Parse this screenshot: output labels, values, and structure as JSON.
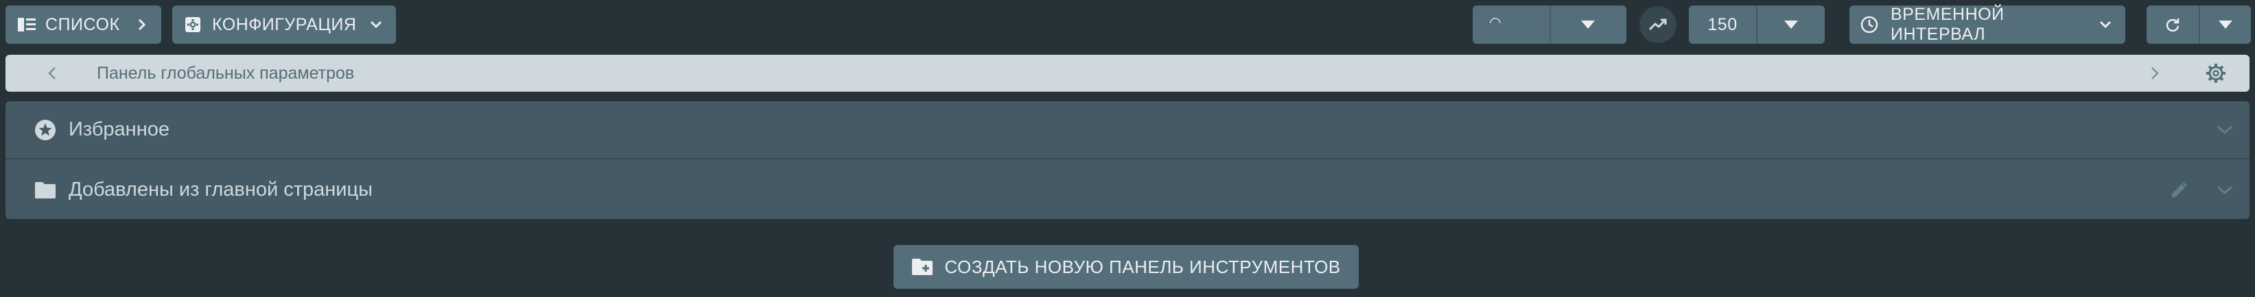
{
  "toolbar": {
    "list_label": "СПИСОК",
    "config_label": "КОНФИГУРАЦИЯ",
    "theme_value": "◠",
    "limit_value": "150",
    "time_label": "ВРЕМЕННОЙ ИНТЕРВАЛ"
  },
  "global_bar": {
    "title": "Панель глобальных параметров"
  },
  "panels": [
    {
      "label": "Избранное",
      "icon": "star-circle-icon"
    },
    {
      "label": "Добавлены из главной страницы",
      "icon": "folder-icon"
    }
  ],
  "create_button": {
    "label": "СОЗДАТЬ НОВУЮ ПАНЕЛЬ ИНСТРУМЕНТОВ",
    "icon": "folder-plus-icon"
  },
  "colors": {
    "background": "#263238",
    "button": "#546e7a",
    "panel": "#455a64",
    "global_bar": "#cfd8dc"
  }
}
